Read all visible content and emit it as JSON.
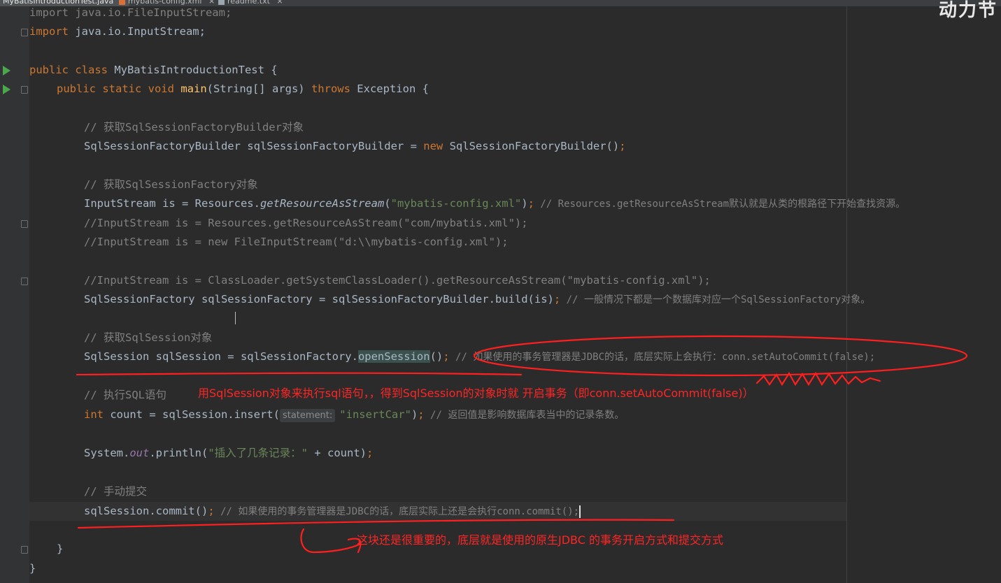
{
  "tabs": [
    {
      "label": "MyBatisIntroductionTest.java",
      "active": true
    },
    {
      "label": "mybatis-config.xml",
      "active": false
    },
    {
      "label": "readme.txt",
      "active": false
    }
  ],
  "watermark": "动力节",
  "code": {
    "line_import1": "import java.io.FileInputStream;",
    "import_kw": "import",
    "import2_rest": " java.io.InputStream;",
    "class_kw": "public class",
    "class_name": " MyBatisIntroductionTest {",
    "main_kw1": "public static void",
    "main_fn": "main",
    "main_args": "(String[] args) ",
    "main_throws": "throws",
    "main_exc": " Exception {",
    "c1": "// 获取SqlSessionFactoryBuilder对象",
    "l1_a": "SqlSessionFactoryBuilder sqlSessionFactoryBuilder = ",
    "l1_new": "new",
    "l1_b": " SqlSessionFactoryBuilder()",
    "semi": ";",
    "c2": "// 获取SqlSessionFactory对象",
    "l2_a": "InputStream is = Resources.",
    "l2_m": "getResourceAsStream",
    "l2_p": "(",
    "l2_s": "\"mybatis-config.xml\"",
    "l2_e": ")",
    "l2_c": " // Resources.getResourceAsStream默认就是从类的根路径下开始查找资源。",
    "l3": "//InputStream is = Resources.getResourceAsStream(\"com/mybatis.xml\");",
    "l4": "//InputStream is = new FileInputStream(\"d:\\\\mybatis-config.xml\");",
    "l5": "//InputStream is = ClassLoader.getSystemClassLoader().getResourceAsStream(\"mybatis-config.xml\");",
    "l6_a": "SqlSessionFactory sqlSessionFactory = sqlSessionFactoryBuilder.build(is)",
    "l6_c": " // 一般情况下都是一个数据库对应一个SqlSessionFactory对象。",
    "c3": "// 获取SqlSession对象",
    "l7_a": "SqlSession sqlSession = sqlSessionFactory.",
    "l7_m": "openSession",
    "l7_b": "()",
    "l7_c": " // 如果使用的事务管理器是JDBC的话，底层实际上会执行：conn.setAutoCommit(false);",
    "c4": "// 执行SQL语句",
    "l8_kw": "int",
    "l8_a": " count = sqlSession.insert(",
    "l8_hint": "statement:",
    "l8_s": "\"insertCar\"",
    "l8_e": ")",
    "l8_c": " // 返回值是影响数据库表当中的记录条数。",
    "l9_a": "System.",
    "l9_out": "out",
    "l9_b": ".println(",
    "l9_s": "\"插入了几条记录：\"",
    "l9_e": " + count)",
    "c5": "// 手动提交",
    "l10_a": "sqlSession.commit()",
    "l10_c": " // 如果使用的事务管理器是JDBC的话，底层实际上还是会执行conn.commit();",
    "close_main": "}",
    "close_class": "}"
  },
  "annotations": {
    "note1": "用SqlSession对象来执行sql语句，，得到SqlSession的对象时就  开启事务（即conn.setAutoCommit(false)）",
    "note2": "这块还是很重要的，底层就是使用的原生JDBC 的事务开启方式和提交方式"
  },
  "colors": {
    "background": "#2b2b2b",
    "keyword": "#cc7832",
    "string": "#6a8759",
    "comment": "#808080",
    "annotation": "#ff2525"
  }
}
